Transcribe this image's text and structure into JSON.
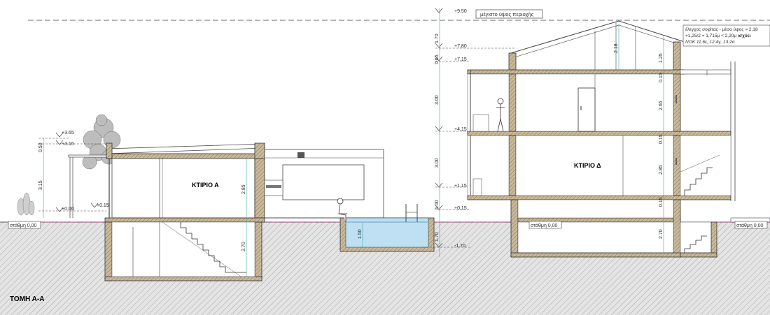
{
  "title": "ΤΟΜΗ Α-Α",
  "max_height_label": "μέγιστο ύψος περιοχής",
  "roof_check": {
    "line1": "έλεγχος σοφίτας - μέσο ύψος =  2,18",
    "line2a": "+1,25/2 = 1,715μ < 2,20μ ",
    "line2b": "ισχύει",
    "line3": "ΝΟΚ 11.6ε, 12.4γ, 13.2α"
  },
  "buildings": {
    "a": "ΚΤΙΡΙΟ Α",
    "d": "ΚΤΙΡΙΟ Δ"
  },
  "datum_labels": {
    "left": "στάθμη 0,00",
    "middle": "στάθμη 0,00",
    "right": "στάθμη 0,00"
  },
  "left_levels": {
    "plus365": "+3.65",
    "plus315": "+3.15",
    "plus000": "+0.00",
    "plus015": "+0.15"
  },
  "left_dims": {
    "d050": "0.50",
    "d315": "3.15",
    "d285": "2.85",
    "d270": "2.70"
  },
  "center_levels": {
    "plus950": "+9.50",
    "plus780": "+7.80",
    "plus715": "+7.15",
    "plus415": "+4.15",
    "plus115": "+1.15",
    "plus015": "+0.15",
    "minus170": "-1.70"
  },
  "center_dims": {
    "d170a": "1.70",
    "d065": "0.65",
    "d300a": "3.00",
    "d300b": "3.00",
    "d100": "1.00",
    "d170b": "1.70",
    "pool": "1.50"
  },
  "right_dims": {
    "d218": "2.18",
    "d125": "1.25",
    "d015a": "0.15",
    "d265": "2.65",
    "d015b": "0.15",
    "d285": "2.85",
    "d015c": "0.15",
    "d270": "2.70"
  },
  "colors": {
    "wall_fill": "#c9b99a",
    "ground_hatch": "#8c8c8c",
    "pool_water": "#bfe0f2",
    "datum_line": "#d2399a",
    "dim_line": "#3aa8b0"
  }
}
